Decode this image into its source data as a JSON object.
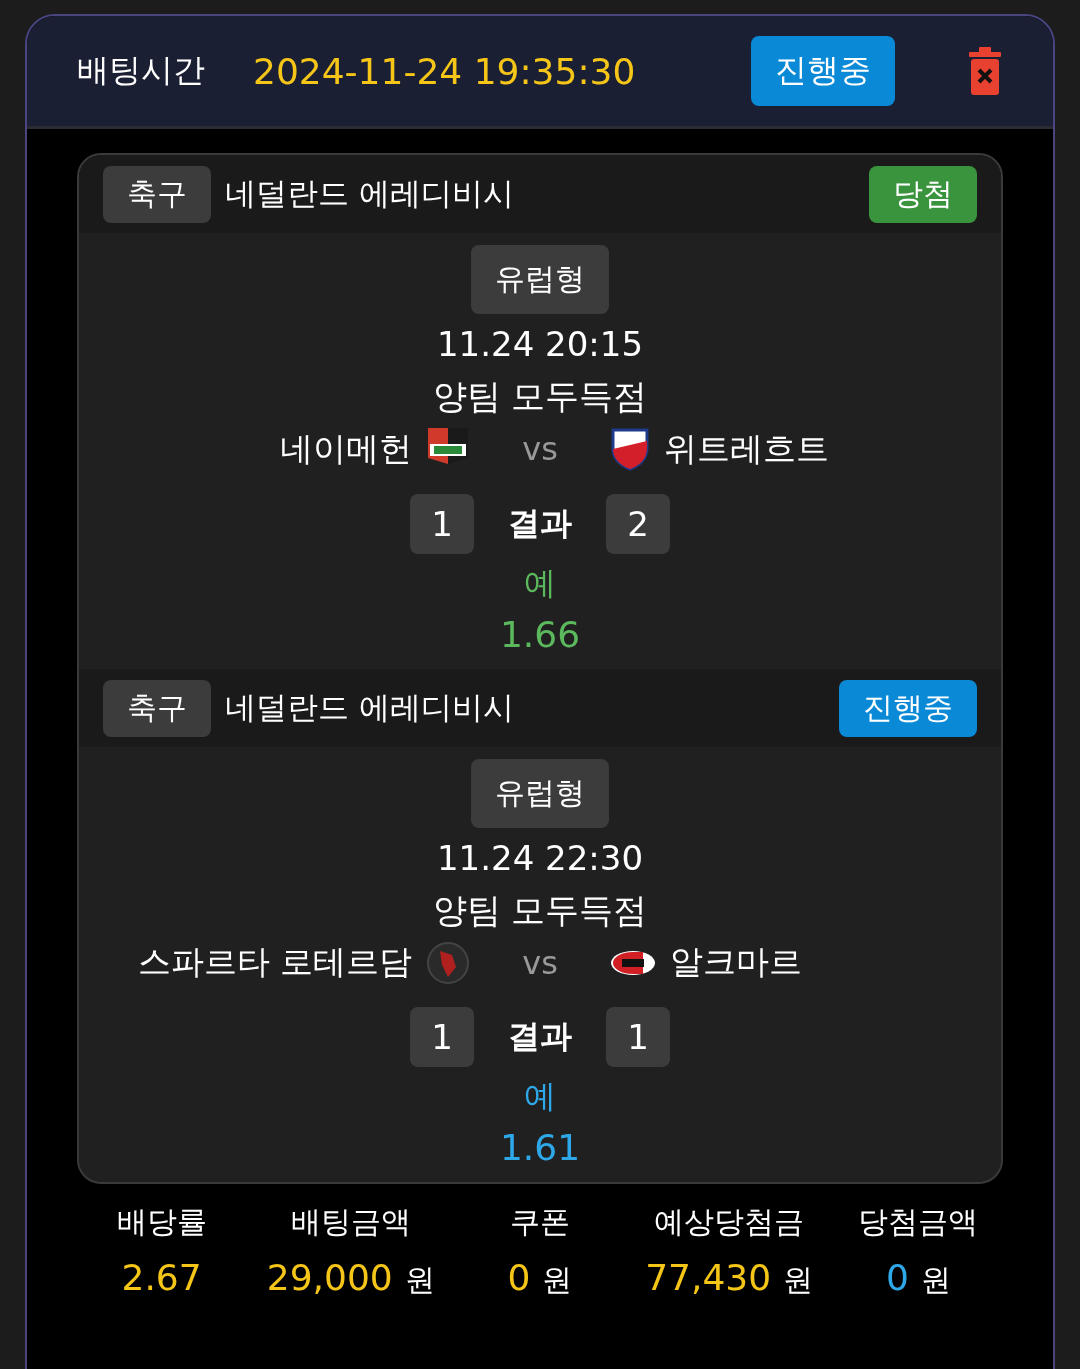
{
  "header": {
    "label": "배팅시간",
    "datetime": "2024-11-24 19:35:30",
    "status": {
      "label": "진행중",
      "kind": "in_progress"
    }
  },
  "matches": [
    {
      "sport": "축구",
      "league": "네덜란드 에레디비시",
      "status": {
        "label": "당첨",
        "kind": "won"
      },
      "bet_type": "유럽형",
      "time": "11.24 20:15",
      "market": "양팀 모두득점",
      "home": "네이메헌",
      "vs": "vs",
      "away": "위트레흐트",
      "home_score": "1",
      "result_label": "결과",
      "away_score": "2",
      "pick": "예",
      "odds": "1.66"
    },
    {
      "sport": "축구",
      "league": "네덜란드 에레디비시",
      "status": {
        "label": "진행중",
        "kind": "in_progress"
      },
      "bet_type": "유럽형",
      "time": "11.24 22:30",
      "market": "양팀 모두득점",
      "home": "스파르타 로테르담",
      "vs": "vs",
      "away": "알크마르",
      "home_score": "1",
      "result_label": "결과",
      "away_score": "1",
      "pick": "예",
      "odds": "1.61"
    }
  ],
  "summary": [
    {
      "label": "배당률",
      "value": "2.67",
      "color": "#f5c518"
    },
    {
      "label": "배팅금액",
      "value": "29,000",
      "unit": "원",
      "color": "#f5c518"
    },
    {
      "label": "쿠폰",
      "value": "0",
      "unit": "원",
      "color": "#f5c518"
    },
    {
      "label": "예상당첨금",
      "value": "77,430",
      "unit": "원",
      "color": "#f5c518"
    },
    {
      "label": "당첨금액",
      "value": "0",
      "unit": "원",
      "color": "#2ea8e8"
    }
  ]
}
